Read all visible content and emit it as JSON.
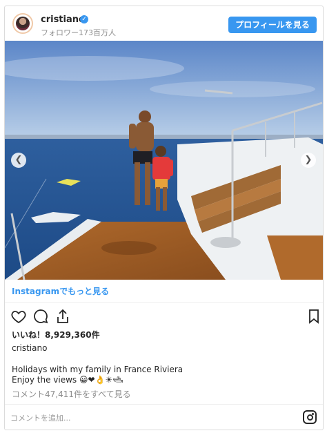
{
  "header": {
    "username": "cristiano",
    "followers": "フォロワー173百万人",
    "profile_button": "プロフィールを見る"
  },
  "photo": {
    "prev_icon": "chevron-left-icon",
    "next_icon": "chevron-right-icon"
  },
  "link": {
    "instagram_more": "Instagramでもっと見る"
  },
  "actions": {
    "icons": [
      "heart-icon",
      "comment-icon",
      "share-icon",
      "bookmark-icon"
    ]
  },
  "likes": "いいね！8,929,360件",
  "caption": {
    "username": "cristiano",
    "line1": "Holidays with my family in France Riviera",
    "line2": "Enjoy the views 😀❤👌☀🛥"
  },
  "comments_link": "コメント47,411件をすべて見る",
  "comment_input": {
    "placeholder": "コメントを追加..."
  },
  "colors": {
    "accent": "#3897f0",
    "text": "#262626",
    "muted": "#8e8e8e"
  }
}
